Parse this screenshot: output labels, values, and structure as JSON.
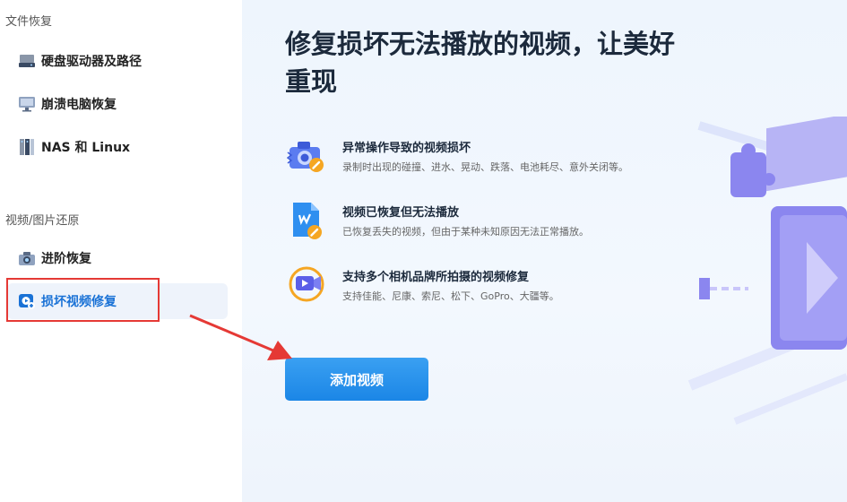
{
  "sidebar": {
    "section1_title": "文件恢复",
    "section2_title": "视频/图片还原",
    "items": [
      {
        "label": "硬盘驱动器及路径",
        "icon": "hard-drive-icon"
      },
      {
        "label": "崩溃电脑恢复",
        "icon": "monitor-icon"
      },
      {
        "label": "NAS 和 Linux",
        "icon": "nas-icon"
      },
      {
        "label": "进阶恢复",
        "icon": "camera-icon"
      },
      {
        "label": "损坏视频修复",
        "icon": "video-repair-icon",
        "active": true
      }
    ]
  },
  "main": {
    "title": "修复损坏无法播放的视频，让美好重现",
    "features": [
      {
        "title": "异常操作导致的视频损坏",
        "desc": "录制时出现的碰撞、进水、晃动、跌落、电池耗尽、意外关闭等。",
        "icon": "camera-repair-icon"
      },
      {
        "title": "视频已恢复但无法播放",
        "desc": "已恢复丢失的视频，但由于某种未知原因无法正常播放。",
        "icon": "file-video-repair-icon"
      },
      {
        "title": "支持多个相机品牌所拍摄的视频修复",
        "desc": "支持佳能、尼康、索尼、松下、GoPro、大疆等。",
        "icon": "video-camera-icon"
      }
    ],
    "add_button": "添加视频"
  },
  "colors": {
    "accent": "#1a86e6",
    "highlight_border": "#e53935",
    "arrow": "#e53935"
  }
}
